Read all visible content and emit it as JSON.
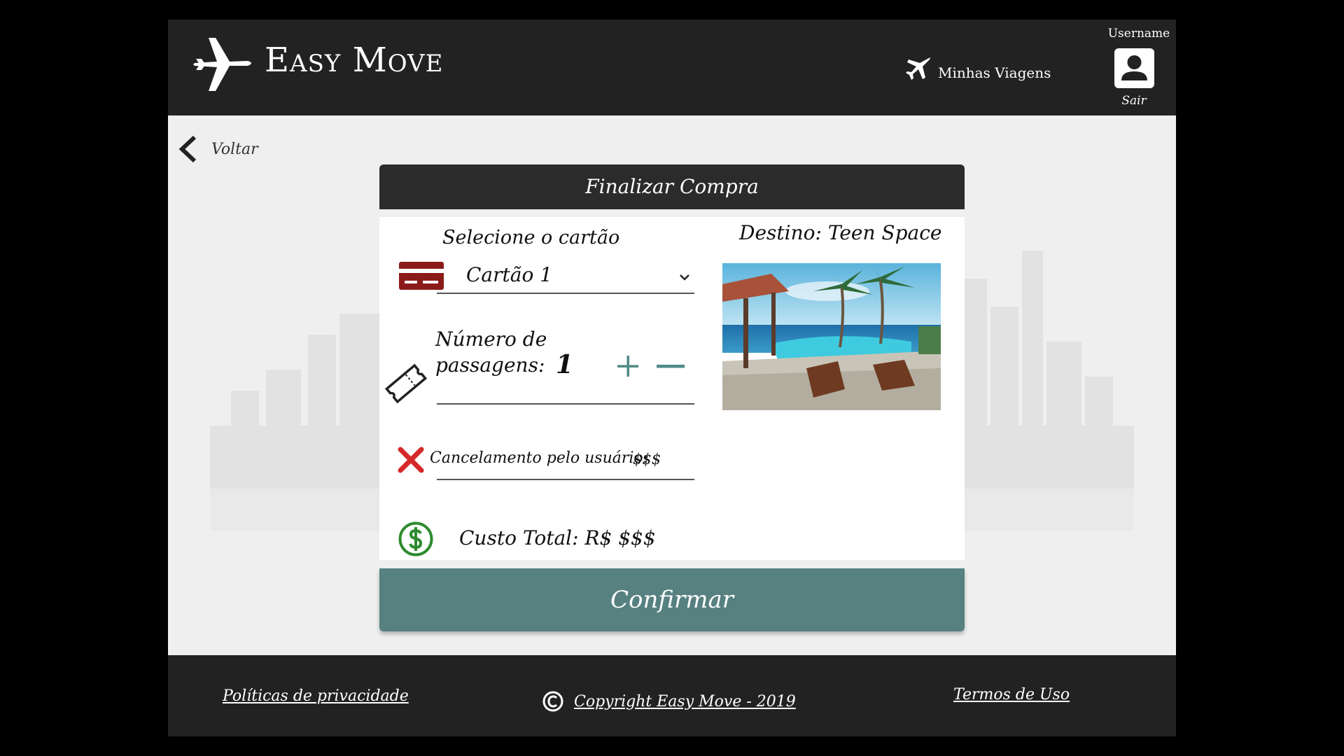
{
  "header": {
    "brand": "Easy Move",
    "trips_label": "Minhas Viagens",
    "username": "Username",
    "logout_label": "Sair"
  },
  "nav": {
    "back_label": "Voltar"
  },
  "checkout": {
    "title": "Finalizar Compra",
    "card_select_label": "Selecione o cartão",
    "card_selected": "Cartão 1",
    "passengers_label_line1": "Número de",
    "passengers_label_line2": "passagens:",
    "passengers_value": "1",
    "cancel_label": "Cancelamento pelo usuário:",
    "cancel_value": "$$$",
    "total_label": "Custo Total: R$ $$$",
    "destination_label": "Destino: Teen Space",
    "confirm_label": "Confirmar"
  },
  "footer": {
    "privacy_label": "Políticas de privacidade",
    "copyright_label": "Copyright Easy Move - 2019",
    "terms_label": "Termos de Uso"
  },
  "colors": {
    "header_bg": "#222222",
    "confirm_bg": "#578080",
    "card_icon": "#8b1a1a",
    "cancel_icon": "#d62828",
    "dollar_icon": "#2e8b2e",
    "stepper_icon": "#4f8a86"
  },
  "icons": {
    "logo": "airplane-icon",
    "trips": "plane-icon",
    "user": "user-icon",
    "back": "chevron-left-icon",
    "card": "credit-card-icon",
    "ticket": "ticket-icon",
    "cancel": "x-icon",
    "total": "dollar-icon",
    "copyright": "copyright-icon"
  }
}
